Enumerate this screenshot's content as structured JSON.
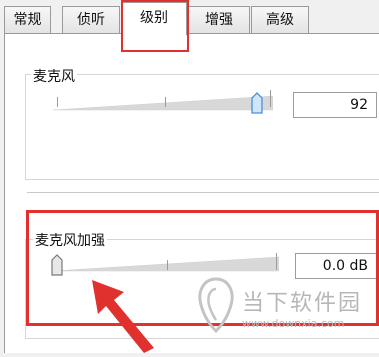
{
  "tabs": [
    "常规",
    "侦听",
    "级别",
    "增强",
    "高级"
  ],
  "active_tab": "级别",
  "microphone": {
    "label": "麦克风",
    "value": "92",
    "level": 0.92
  },
  "boost": {
    "label": "麦克风加强",
    "value": "0.0 dB",
    "level": 0.0
  },
  "watermark": {
    "title": "当下软件园",
    "url": "www.downxia.com"
  },
  "colors": {
    "highlight": "#e0312e",
    "thumb_blue": "#4a90d9",
    "track": "#d8d8d8"
  }
}
